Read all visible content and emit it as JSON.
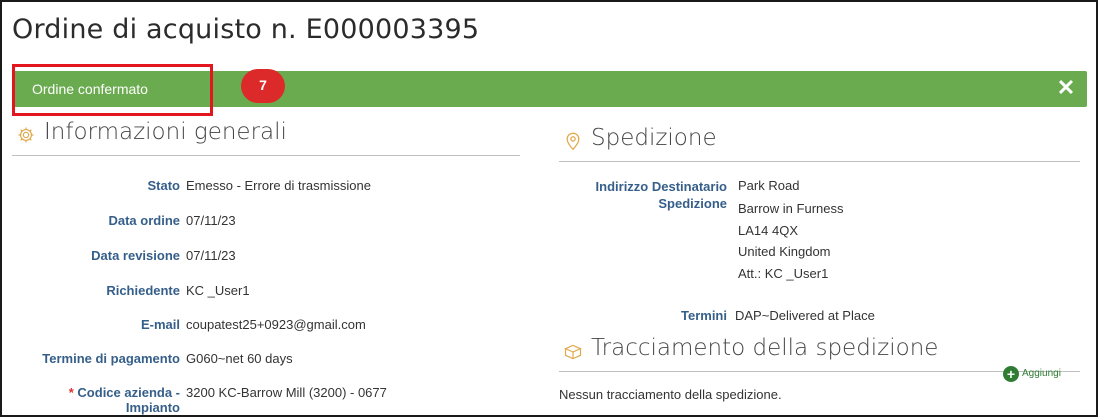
{
  "page": {
    "title": "Ordine di acquisto n. E000003395"
  },
  "banner": {
    "message": "Ordine confermato",
    "close_glyph": "✕",
    "step_number": "7",
    "accent_color": "#6aab4f",
    "highlight_color": "#e3161f"
  },
  "general": {
    "heading": "Informazioni generali",
    "icon": "gear-icon",
    "fields": [
      {
        "label": "Stato",
        "value": "Emesso - Errore di trasmissione"
      },
      {
        "label": "Data ordine",
        "value": "07/11/23"
      },
      {
        "label": "Data revisione",
        "value": "07/11/23"
      },
      {
        "label": "Richiedente",
        "value": "KC _User1"
      },
      {
        "label": "E-mail",
        "value": "coupatest25+0923@gmail.com"
      },
      {
        "label": "Termine di pagamento",
        "value": "G060~net 60 days"
      }
    ],
    "company": {
      "required_marker": "*",
      "label_line1": "Codice azienda -",
      "label_line2": "Impianto",
      "value": "3200 KC-Barrow Mill (3200) - 0677"
    }
  },
  "shipping": {
    "heading": "Spedizione",
    "icon": "map-pin-icon",
    "address_label_line1": "Indirizzo Destinatario",
    "address_label_line2": "Spedizione",
    "address_lines": [
      "Park Road",
      "Barrow in Furness",
      "LA14 4QX",
      "United Kingdom",
      "Att.: KC _User1"
    ],
    "terms_label": "Termini",
    "terms_value": "DAP~Delivered at Place"
  },
  "tracking": {
    "heading": "Tracciamento della spedizione",
    "icon": "package-icon",
    "add_label": "Aggiungi",
    "empty_text": "Nessun tracciamento della spedizione."
  }
}
